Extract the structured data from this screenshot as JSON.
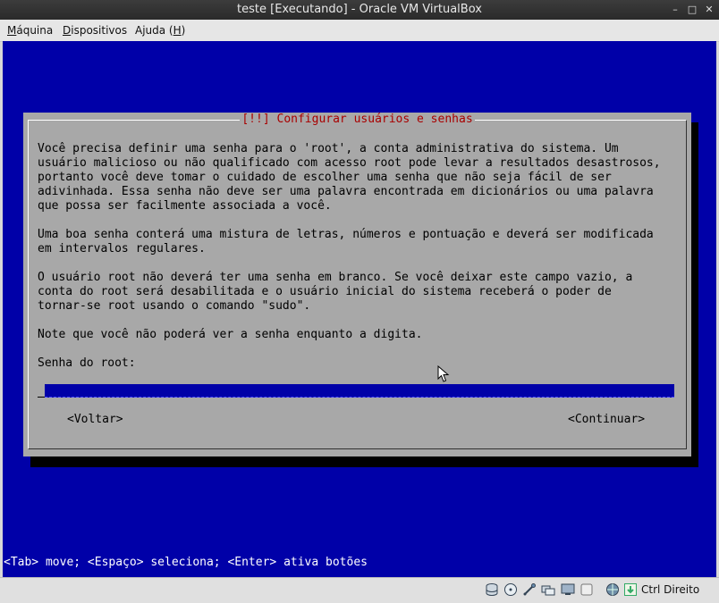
{
  "window": {
    "title": "teste [Executando] - Oracle VM VirtualBox",
    "minimize_glyph": "–",
    "maximize_glyph": "□",
    "close_glyph": "✕"
  },
  "menu": {
    "items": [
      {
        "mnemonic": "M",
        "rest": "áquina"
      },
      {
        "mnemonic": "D",
        "rest": "ispositivos"
      },
      {
        "label": "Ajuda (",
        "mnemonic": "H",
        "tail": ")"
      }
    ]
  },
  "dialog": {
    "title": "[!!] Configurar usuários e senhas",
    "paragraph1": "Você precisa definir uma senha para o 'root', a conta administrativa do sistema. Um\nusuário malicioso ou não qualificado com acesso root pode levar a resultados desastrosos,\nportanto você deve tomar o cuidado de escolher uma senha que não seja fácil de ser\nadivinhada. Essa senha não deve ser uma palavra encontrada em dicionários ou uma palavra\nque possa ser facilmente associada a você.",
    "paragraph2": "Uma boa senha conterá uma mistura de letras, números e pontuação e deverá ser modificada\nem intervalos regulares.",
    "paragraph3": "O usuário root não deverá ter uma senha em branco. Se você deixar este campo vazio, a\nconta do root será desabilitada e o usuário inicial do sistema receberá o poder de\ntornar-se root usando o comando \"sudo\".",
    "paragraph4": "Note que você não poderá ver a senha enquanto a digita.",
    "field_label": "Senha do root:",
    "field_value": "",
    "back_button": "<Voltar>",
    "continue_button": "<Continuar>"
  },
  "help_line": "<Tab> move; <Espaço> seleciona; <Enter> ativa botões",
  "status": {
    "icons": [
      "hard-disk-icon",
      "optical-drive-icon",
      "usb-icon",
      "shared-folders-icon",
      "display-icon",
      "capture-icon",
      "network-icon",
      "host-key-icon"
    ],
    "host_key": "Ctrl Direito"
  },
  "colors": {
    "screen_bg": "#0000a8",
    "dialog_bg": "#a8a8a8",
    "title_fg": "#a80000"
  }
}
